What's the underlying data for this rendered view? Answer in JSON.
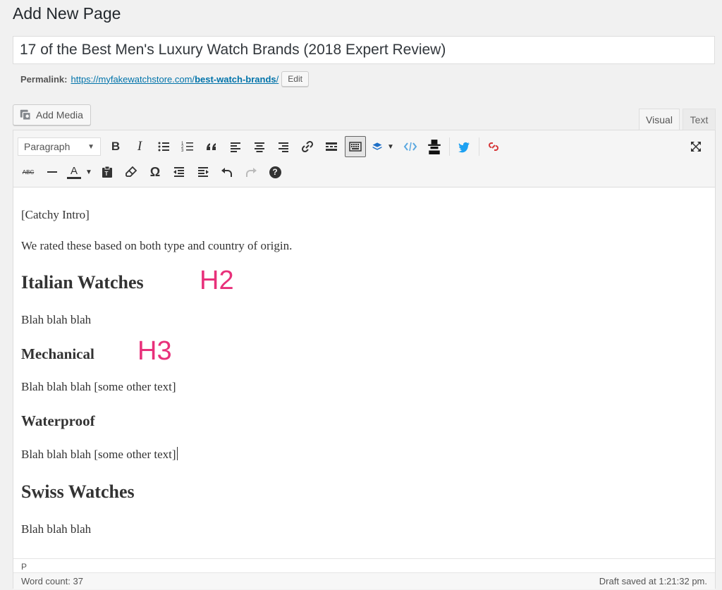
{
  "page": {
    "heading": "Add New Page"
  },
  "post": {
    "title": "17 of the Best Men's Luxury Watch Brands (2018 Expert Review)",
    "permalink_label": "Permalink:",
    "permalink_base": "https://myfakewatchstore.com/",
    "permalink_slug": "best-watch-brands",
    "permalink_trailing": "/",
    "edit_label": "Edit"
  },
  "media": {
    "add_media_label": "Add Media"
  },
  "tabs": {
    "visual": "Visual",
    "text": "Text"
  },
  "toolbar": {
    "format_value": "Paragraph",
    "row1_icons": [
      "bold-icon",
      "italic-icon",
      "bulleted-list-icon",
      "numbered-list-icon",
      "blockquote-icon",
      "align-left-icon",
      "align-center-icon",
      "align-right-icon",
      "link-icon",
      "read-more-icon",
      "toolbar-toggle-icon",
      "layers-icon",
      "code-icon",
      "spy-icon",
      "twitter-icon",
      "unlink-icon"
    ],
    "row2_icons": [
      "strikethrough-icon",
      "horizontal-line-icon",
      "text-color-icon",
      "paste-text-icon",
      "clear-formatting-icon",
      "special-character-icon",
      "outdent-icon",
      "indent-icon",
      "undo-icon",
      "redo-icon",
      "help-icon"
    ],
    "bold_glyph": "B",
    "italic_glyph": "I",
    "strike_glyph": "ABC",
    "textcolor_glyph": "A",
    "omega_glyph": "Ω",
    "help_glyph": "?"
  },
  "content": {
    "p1": "[Catchy Intro]",
    "p2": "We rated these based on both type and country of origin.",
    "h2_1": "Italian Watches",
    "p3": "Blah blah blah",
    "h3_1": "Mechanical",
    "p4": "Blah blah blah [some other text]",
    "h3_2": "Waterproof",
    "p5": "Blah blah blah [some other text]",
    "h2_2": "Swiss Watches",
    "p6": "Blah blah blah"
  },
  "annotations": {
    "h2": "H2",
    "h3": "H3",
    "color": "#e8307a"
  },
  "status": {
    "path": "P",
    "word_count": "Word count: 37",
    "draft_saved": "Draft saved at 1:21:32 pm."
  }
}
